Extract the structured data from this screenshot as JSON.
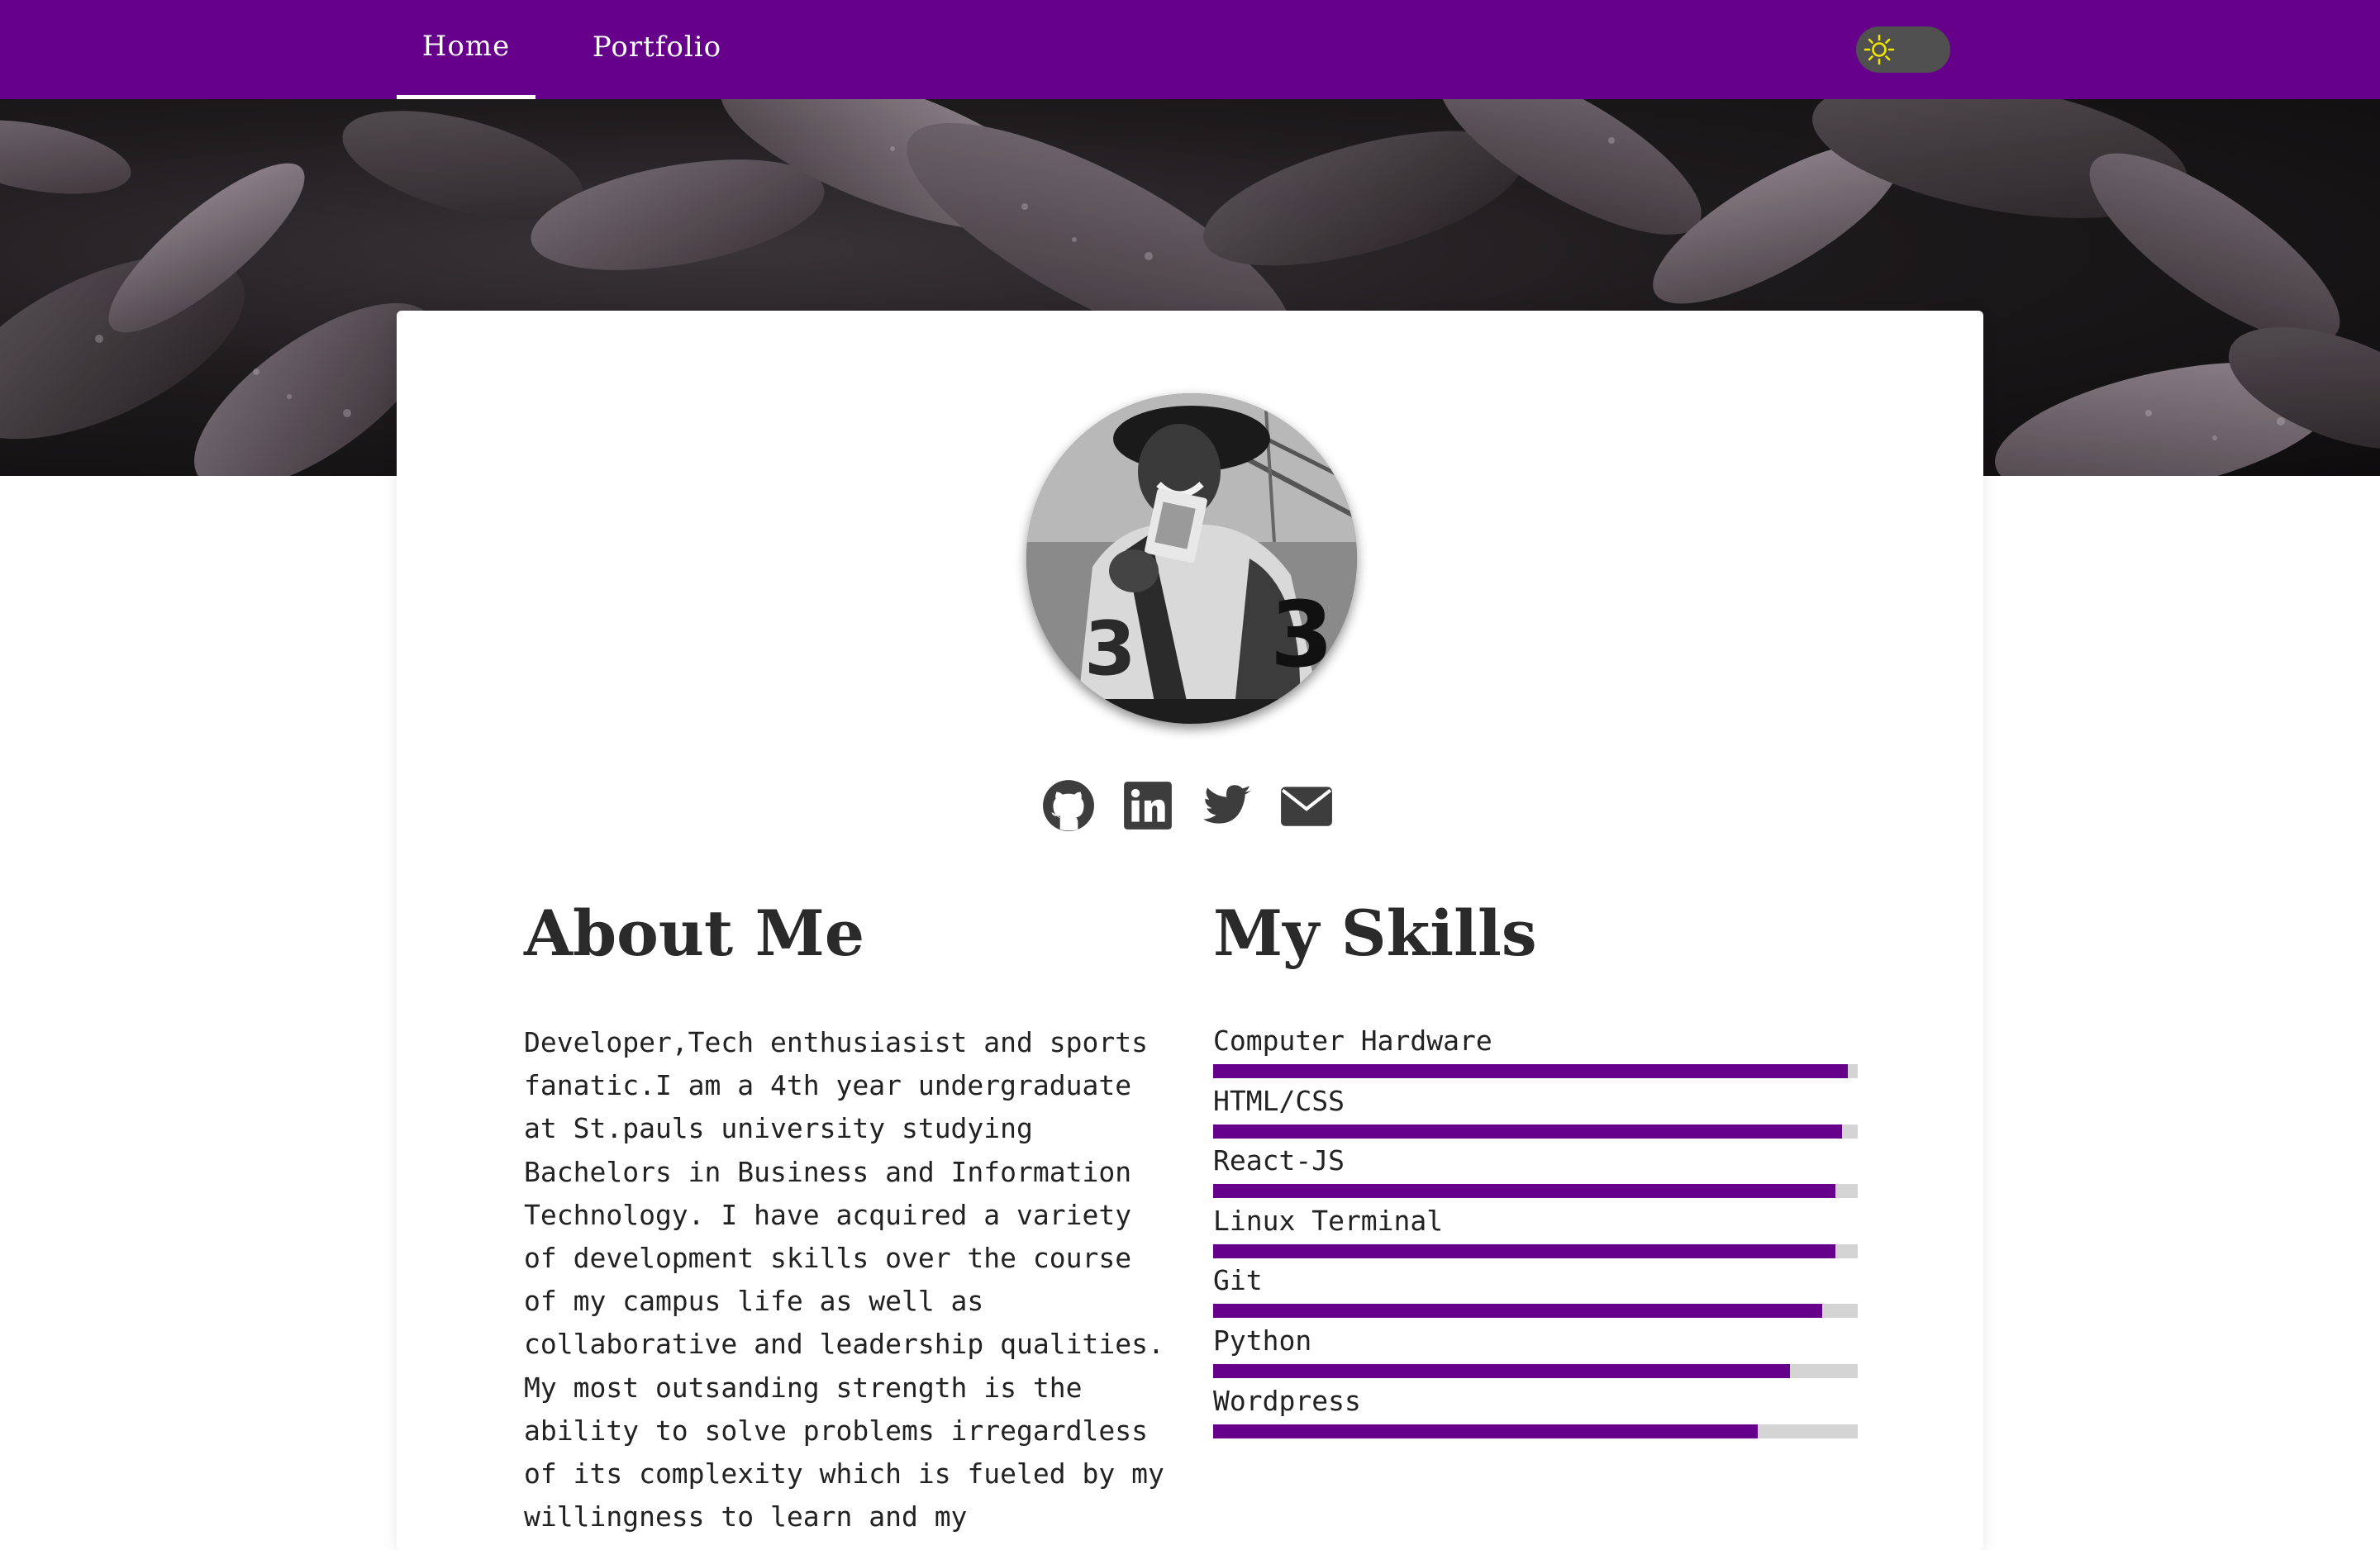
{
  "nav": {
    "tabs": [
      {
        "label": "Home",
        "active": true
      },
      {
        "label": "Portfolio",
        "active": false
      }
    ],
    "theme_toggle": {
      "icon": "sun-icon",
      "mode": "light"
    }
  },
  "colors": {
    "brand": "#66008b",
    "toggle": "#505050",
    "sun": "#f2e600",
    "skill_track": "#d4d4d4"
  },
  "social": [
    {
      "name": "github",
      "icon": "github-icon"
    },
    {
      "name": "linkedin",
      "icon": "linkedin-icon"
    },
    {
      "name": "twitter",
      "icon": "twitter-icon"
    },
    {
      "name": "email",
      "icon": "envelope-icon"
    }
  ],
  "about": {
    "title": "About Me",
    "body": "Developer,Tech enthusiasist and sports fanatic.I am a 4th year undergraduate at St.pauls university studying Bachelors in Business and Information Technology. I have acquired a variety of development skills over the course of my campus life as well as collaborative and leadership qualities. My most outsanding strength is the ability to solve problems irregardless of its complexity which is fueled by my willingness to learn and my"
  },
  "skills": {
    "title": "My Skills",
    "items": [
      {
        "label": "Computer Hardware",
        "level": 0.985
      },
      {
        "label": "HTML/CSS",
        "level": 0.975
      },
      {
        "label": "React-JS",
        "level": 0.965
      },
      {
        "label": "Linux Terminal",
        "level": 0.965
      },
      {
        "label": "Git",
        "level": 0.945
      },
      {
        "label": "Python",
        "level": 0.895
      },
      {
        "label": "Wordpress",
        "level": 0.845
      }
    ]
  }
}
